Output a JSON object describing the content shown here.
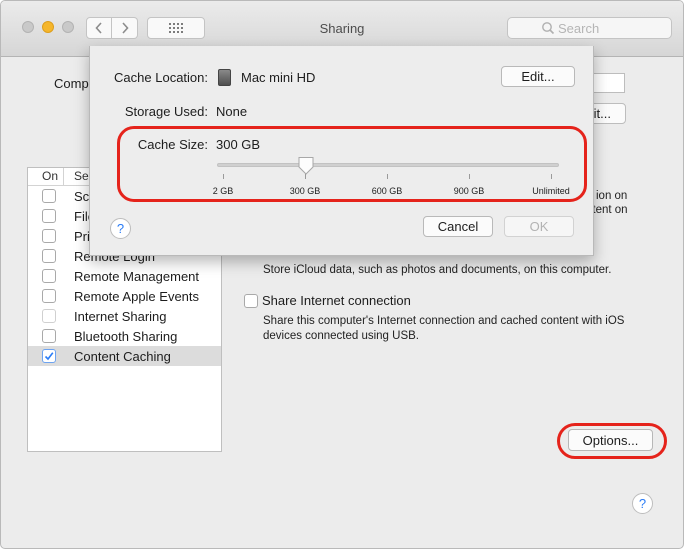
{
  "window": {
    "title": "Sharing",
    "search_placeholder": "Search"
  },
  "main": {
    "computer_name_label_partial": "Comp",
    "edit_button_partial": "it...",
    "services_header_on": "On",
    "services_header_service_partial": "Se",
    "services": [
      {
        "label": "Sc",
        "checked": false
      },
      {
        "label": "File",
        "checked": false
      },
      {
        "label": "Pri",
        "checked": false
      },
      {
        "label": "Remote Login",
        "checked": false
      },
      {
        "label": "Remote Management",
        "checked": false
      },
      {
        "label": "Remote Apple Events",
        "checked": false
      },
      {
        "label": "Internet Sharing",
        "checked": false
      },
      {
        "label": "Bluetooth Sharing",
        "checked": false
      },
      {
        "label": "Content Caching",
        "checked": true,
        "selected": true
      }
    ],
    "desc_cut_1": "ion on",
    "desc_cut_2": "ntent on",
    "icloud_desc": "Store iCloud data, such as photos and documents, on this computer.",
    "share_internet_label": "Share Internet connection",
    "share_internet_desc": "Share this computer's Internet connection and cached content with iOS devices connected using USB.",
    "options_button": "Options...",
    "help_icon": "?"
  },
  "sheet": {
    "cache_location_label": "Cache Location:",
    "cache_location_value": "Mac mini HD",
    "edit_button": "Edit...",
    "storage_used_label": "Storage Used:",
    "storage_used_value": "None",
    "cache_size_label": "Cache Size:",
    "cache_size_value": "300 GB",
    "slider_value_fraction": 0.25,
    "slider_ticks": [
      "2 GB",
      "300 GB",
      "600 GB",
      "900 GB",
      "Unlimited"
    ],
    "cancel_button": "Cancel",
    "ok_button": "OK",
    "help_icon": "?"
  },
  "colors": {
    "highlight_ring": "#e5231b",
    "accent_blue": "#3b82f7"
  }
}
